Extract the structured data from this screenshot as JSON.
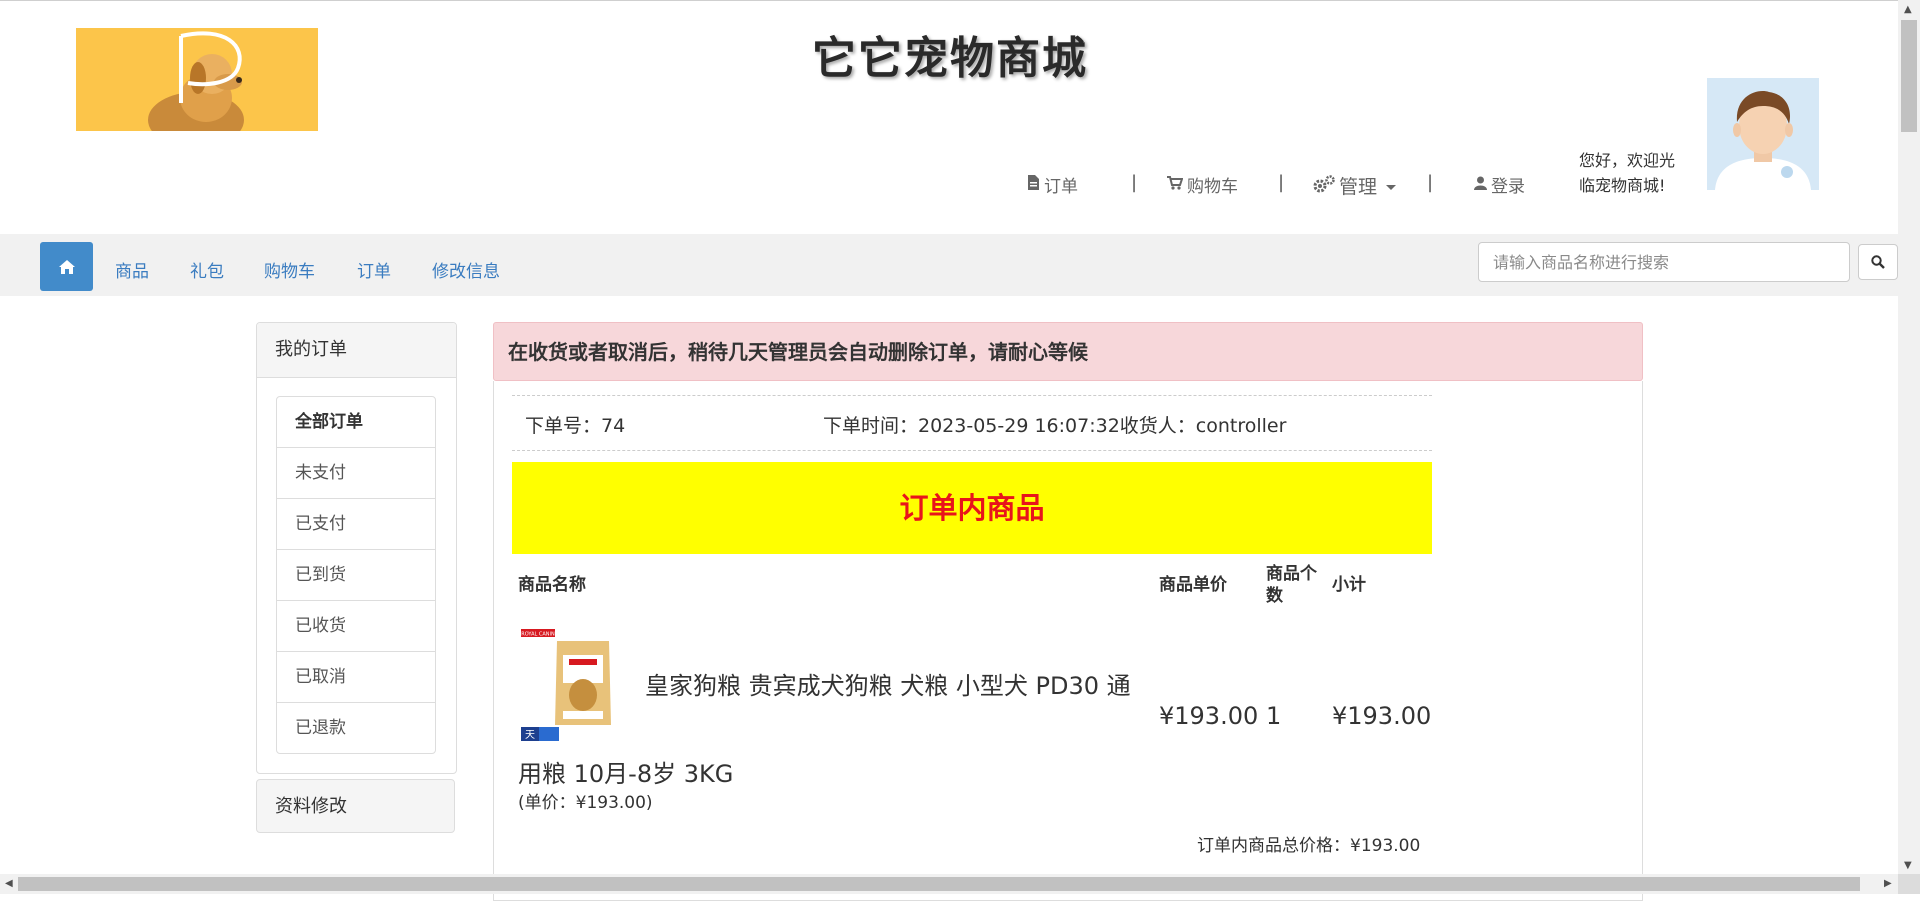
{
  "header": {
    "site_title": "它它宠物商城",
    "welcome_text": "您好，欢迎光临宠物商城!",
    "links": {
      "orders": "订单",
      "cart": "购物车",
      "manage": "管理",
      "login": "登录",
      "separator": "|"
    }
  },
  "navbar": {
    "items": [
      "商品",
      "礼包",
      "购物车",
      "订单",
      "修改信息"
    ],
    "search_placeholder": "请输入商品名称进行搜索"
  },
  "sidebar": {
    "title": "我的订单",
    "items": [
      "全部订单",
      "未支付",
      "已支付",
      "已到货",
      "已收货",
      "已取消",
      "已退款"
    ],
    "active_index": 0,
    "profile_title": "资料修改"
  },
  "main": {
    "notice": "在收货或者取消后，稍待几天管理员会自动删除订单，请耐心等候",
    "order": {
      "number": "下单号：74",
      "time_receiver": "下单时间：2023-05-29 16:07:32收货人：controller"
    },
    "banner_title": "订单内商品",
    "table_headers": {
      "name": "商品名称",
      "unit_price": "商品单价",
      "quantity": "商品个数",
      "subtotal": "小计"
    },
    "product": {
      "name_line1": "皇家狗粮 贵宾成犬狗粮 犬粮 小型犬 PD30 通",
      "name_line2": "用粮 10月-8岁 3KG",
      "unit_note": "(单价：¥193.00)",
      "unit_price": "¥193.00",
      "quantity": "1",
      "subtotal": "¥193.00",
      "image_brand": "ROYAL CANIN",
      "image_badge": "天"
    },
    "total": "订单内商品总价格：¥193.00"
  },
  "colors": {
    "accent": "#428bca",
    "banner_bg": "#ffff00",
    "banner_text": "#e8141b",
    "alert_bg": "#f7d7da",
    "logo_bg": "#fcc54a"
  }
}
